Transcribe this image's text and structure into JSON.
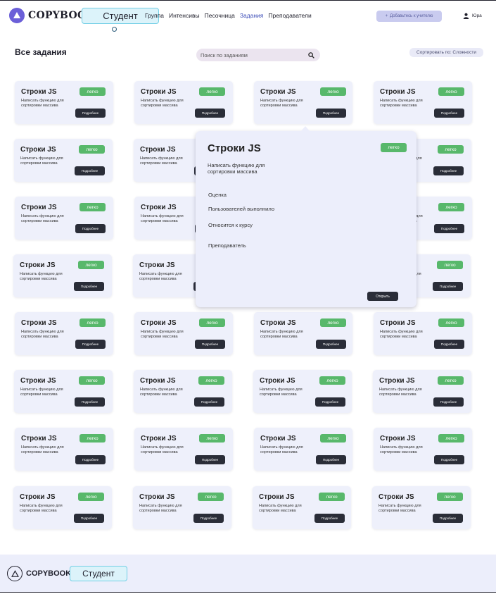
{
  "header": {
    "logo_text": "COPYBOOK",
    "role": "Студент",
    "nav": [
      {
        "label": "Группа",
        "active": false
      },
      {
        "label": "Интенсивы",
        "active": false
      },
      {
        "label": "Песочница",
        "active": false
      },
      {
        "label": "Задания",
        "active": true
      },
      {
        "label": "Преподаватели",
        "active": false
      }
    ],
    "add_teacher_label": "Добавьтесь к учителю",
    "user_name": "Юра"
  },
  "toolbar": {
    "page_title": "Все задания",
    "search_placeholder": "Поиск по заданиям",
    "sort_label": "Сортировать по: Сложности"
  },
  "task_card": {
    "title": "Строки JS",
    "difficulty": "легко",
    "description": "Написать функцию для сортировки массива",
    "details_button": "Подробнее"
  },
  "popover": {
    "title": "Строки JS",
    "difficulty": "легко",
    "description": "Написать функцию для сортировки массива",
    "fields": [
      "Оценка",
      "Пользователей выполнило",
      "Относится к курсу",
      "Преподаватель"
    ],
    "open_button": "Открыть"
  },
  "footer": {
    "logo_text": "COPYBOOK",
    "role": "Студент"
  },
  "colors": {
    "accent": "#6b5fd8",
    "badge_green": "#58b86b",
    "card_bg": "#eef0fb",
    "dark_button": "#2a2d38",
    "role_bg": "#dcf3fa"
  }
}
